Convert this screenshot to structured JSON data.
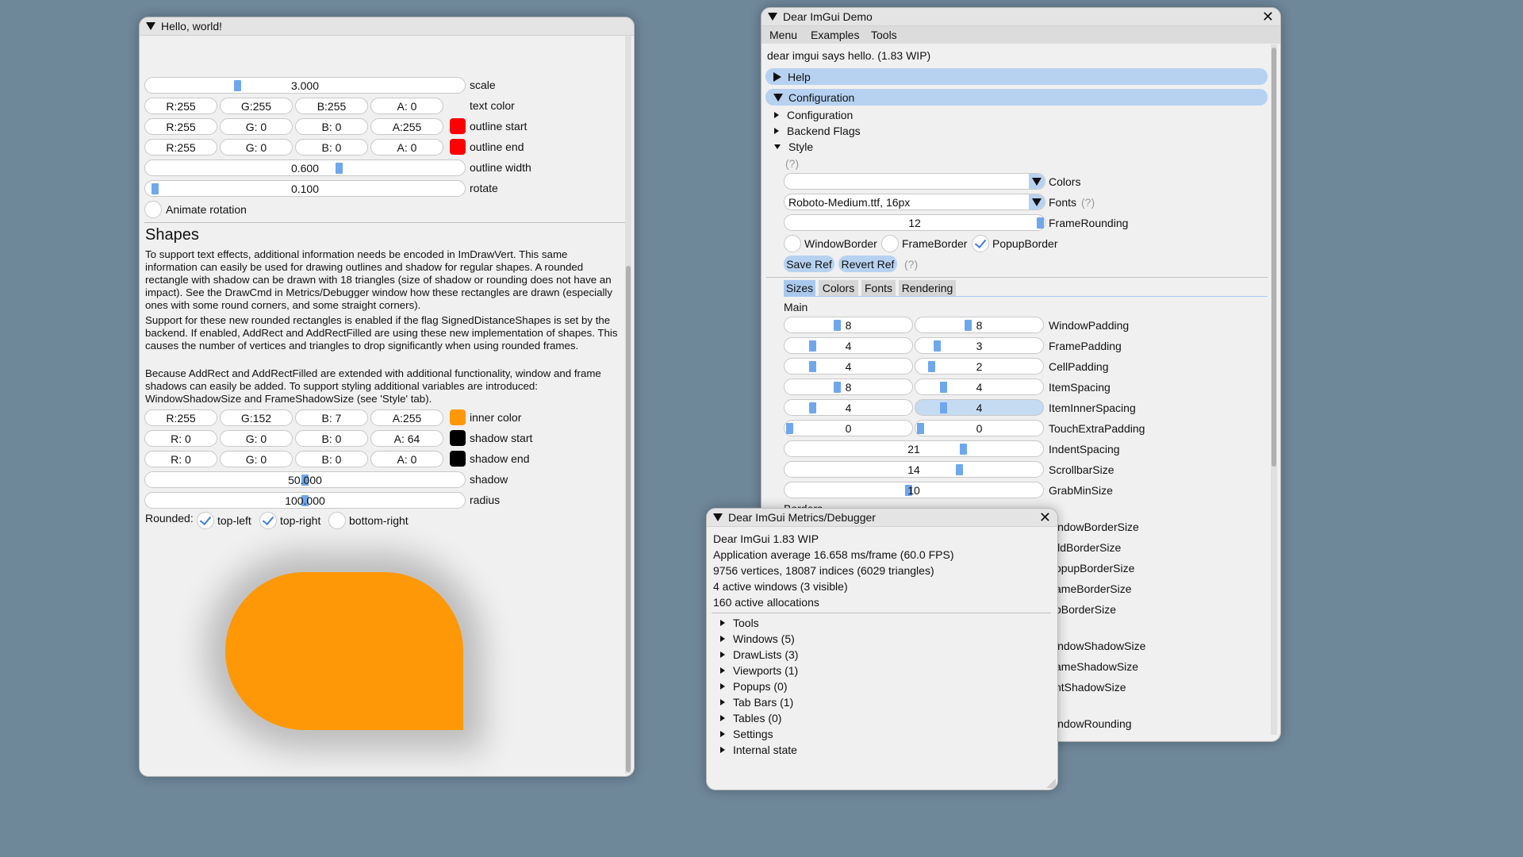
{
  "hello_window": {
    "title": "Hello, world!",
    "sliders": [
      {
        "value": "3.000",
        "label": "scale",
        "fraction": 0.26
      },
      {
        "value": "0.600",
        "label": "outline width",
        "fraction": 0.6
      },
      {
        "value": "0.100",
        "label": "rotate",
        "fraction": 0.02
      }
    ],
    "text_color": {
      "r": "R:255",
      "g": "G:255",
      "b": "B:255",
      "a": "A:  0",
      "label": "text color",
      "swatch": "#f0f0f0"
    },
    "outline_start": {
      "r": "R:255",
      "g": "G:  0",
      "b": "B:  0",
      "a": "A:255",
      "label": "outline start",
      "swatch": "#ff0000"
    },
    "outline_end": {
      "r": "R:255",
      "g": "G:  0",
      "b": "B:  0",
      "a": "A:  0",
      "label": "outline end",
      "swatch": "#ff0000"
    },
    "animate_rotation": "Animate rotation",
    "shapes_heading": "Shapes",
    "para1": "To support text effects, additional information needs be encoded in ImDrawVert. This same information can easily be used for drawing outlines and shadow for regular shapes. A rounded rectangle with shadow can be drawn with 18 triangles (size of shadow or rounding does not have an impact). See the DrawCmd in Metrics/Debugger window how these rectangles are drawn (especially ones with some round corners, and some straight corners).",
    "para2": "Support for these new rounded rectangles is enabled if the flag SignedDistanceShapes is set by the backend. If enabled, AddRect and AddRectFilled are using these new implementation of shapes. This causes the number of vertices and triangles to drop significantly when using rounded frames.",
    "para3": "Because AddRect and AddRectFilled are extended with additional functionality, window and frame shadows can easily be added. To support styling additional variables are introduced: WindowShadowSize and FrameShadowSize (see 'Style' tab).",
    "inner_color": {
      "r": "R:255",
      "g": "G:152",
      "b": "B:  7",
      "a": "A:255",
      "label": "inner color",
      "swatch": "#ff9807"
    },
    "shadow_start": {
      "r": "R:  0",
      "g": "G:  0",
      "b": "B:  0",
      "a": "A: 64",
      "label": "shadow start",
      "swatch": "#000000"
    },
    "shadow_end": {
      "r": "R:  0",
      "g": "G:  0",
      "b": "B:  0",
      "a": "A:  0",
      "label": "shadow end",
      "swatch": "#000000"
    },
    "shadow": {
      "value": "50.000",
      "label": "shadow",
      "fraction": 0.5
    },
    "radius": {
      "value": "100.000",
      "label": "radius",
      "fraction": 0.5
    },
    "rounded_label": "Rounded:",
    "rounded_options": [
      {
        "label": "top-left",
        "checked": true
      },
      {
        "label": "top-right",
        "checked": true
      },
      {
        "label": "bottom-right",
        "checked": false
      }
    ],
    "shape_color": "#ff9807"
  },
  "demo_window": {
    "title": "Dear ImGui Demo",
    "close": "✕",
    "menu": [
      "Menu",
      "Examples",
      "Tools"
    ],
    "hello_text": "dear imgui says hello. (1.83 WIP)",
    "help_header": "Help",
    "config_header": "Configuration",
    "tree": [
      "Configuration",
      "Backend Flags",
      "Style"
    ],
    "help_marker": "(?)",
    "colors_combo_label": "Colors",
    "fonts_combo_value": "Roboto-Medium.ttf, 16px",
    "fonts_combo_label": "Fonts",
    "frame_rounding": {
      "value": "12",
      "label": "FrameRounding"
    },
    "checkboxes": [
      {
        "label": "WindowBorder",
        "checked": false
      },
      {
        "label": "FrameBorder",
        "checked": false
      },
      {
        "label": "PopupBorder",
        "checked": true
      }
    ],
    "save_ref": "Save Ref",
    "revert_ref": "Revert Ref",
    "tabs": [
      "Sizes",
      "Colors",
      "Fonts",
      "Rendering"
    ],
    "main_label": "Main",
    "rows": [
      {
        "a": "8",
        "b": "8",
        "label": "WindowPadding"
      },
      {
        "a": "4",
        "b": "3",
        "label": "FramePadding"
      },
      {
        "a": "4",
        "b": "2",
        "label": "CellPadding"
      },
      {
        "a": "8",
        "b": "4",
        "label": "ItemSpacing"
      },
      {
        "a": "4",
        "b": "4",
        "label": "ItemInnerSpacing"
      },
      {
        "a": "0",
        "b": "0",
        "label": "TouchExtraPadding"
      }
    ],
    "single_rows": [
      {
        "value": "21",
        "label": "IndentSpacing"
      },
      {
        "value": "14",
        "label": "ScrollbarSize"
      },
      {
        "value": "10",
        "label": "GrabMinSize"
      }
    ],
    "borders_label": "Borders",
    "hidden_labels": [
      "indowBorderSize",
      "ildBorderSize",
      "opupBorderSize",
      "ameBorderSize",
      "bBorderSize",
      "indowShadowSize",
      "ameShadowSize",
      "ntShadowSize",
      "indowRounding"
    ]
  },
  "metrics_window": {
    "title": "Dear ImGui Metrics/Debugger",
    "close": "✕",
    "lines": [
      "Dear ImGui 1.83 WIP",
      "Application average 16.658 ms/frame (60.0 FPS)",
      "9756 vertices, 18087 indices (6029 triangles)",
      "4 active windows (3 visible)",
      "160 active allocations"
    ],
    "items": [
      "Tools",
      "Windows (5)",
      "DrawLists (3)",
      "Viewports (1)",
      "Popups (0)",
      "Tab Bars (1)",
      "Tables (0)",
      "Settings",
      "Internal state"
    ]
  }
}
